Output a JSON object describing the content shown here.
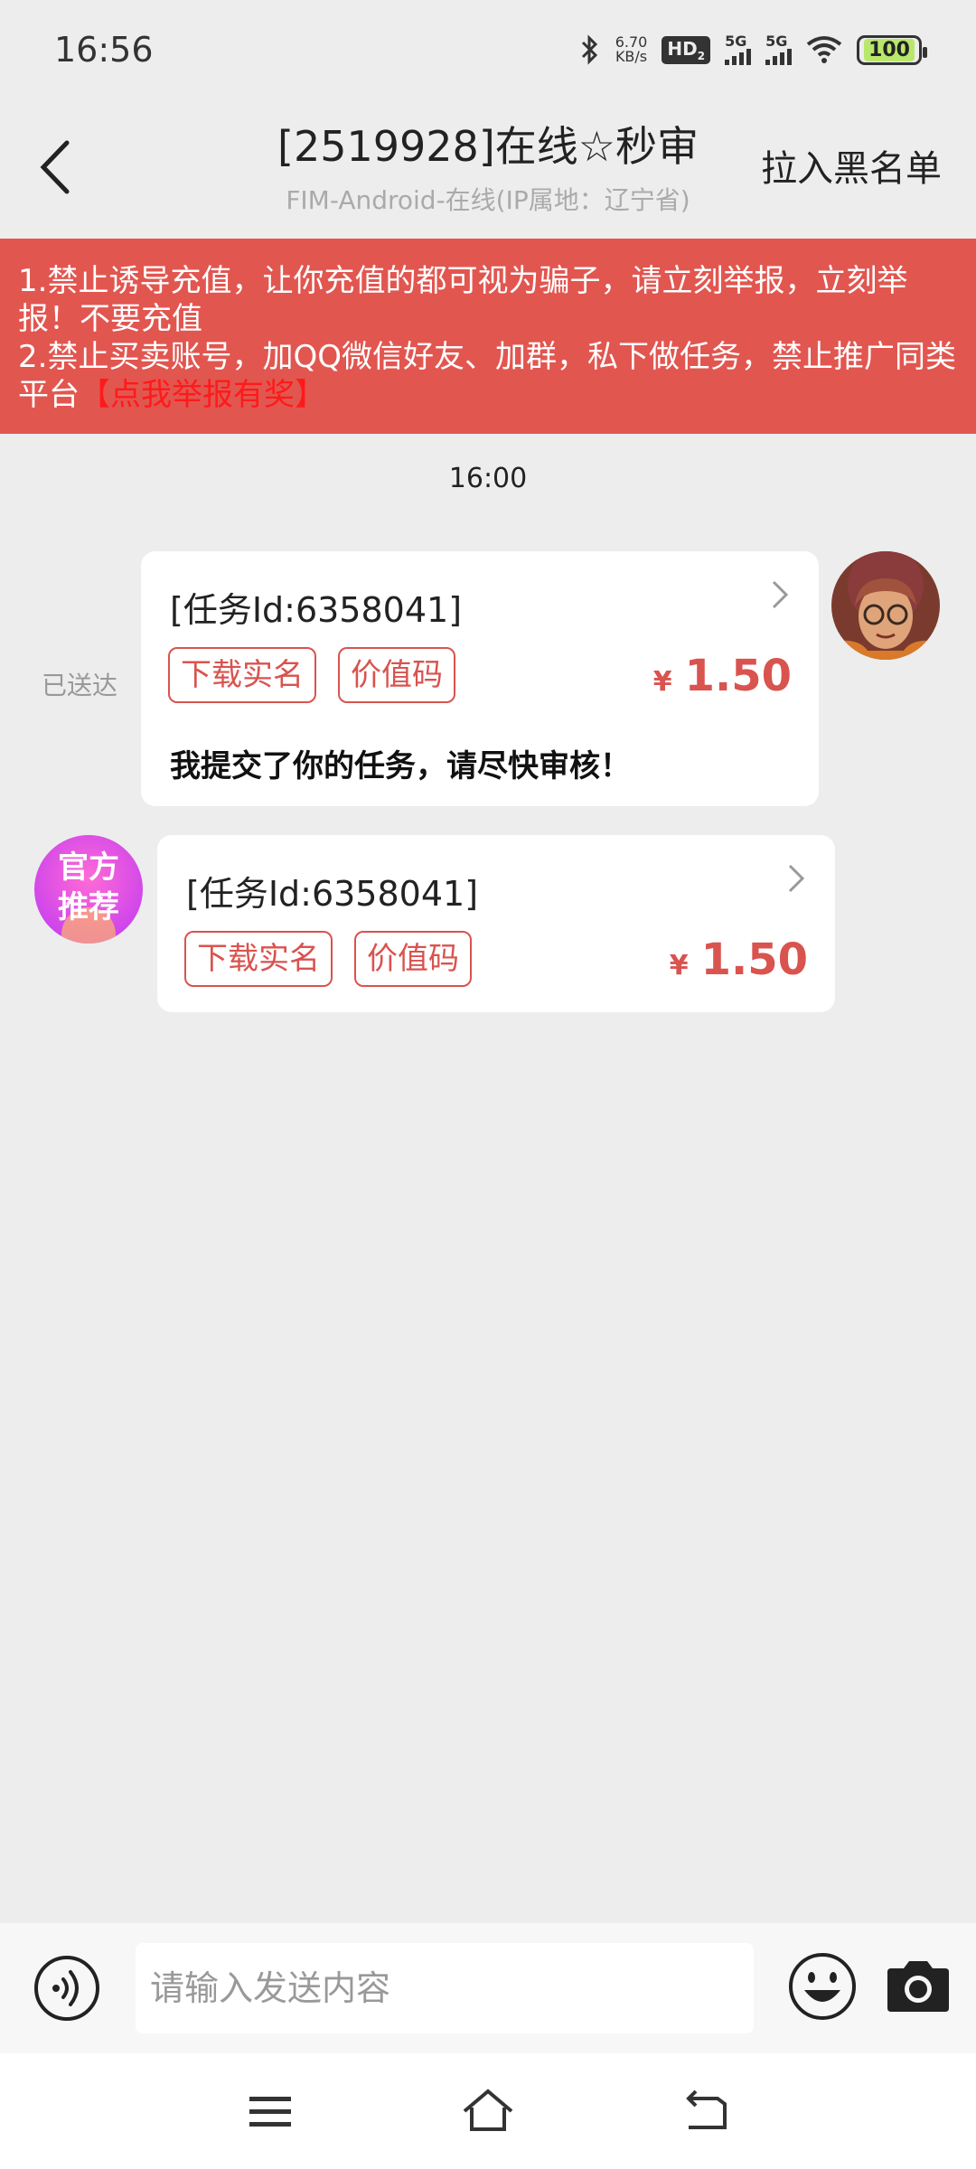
{
  "status_bar": {
    "time": "16:56",
    "net_speed_value": "6.70",
    "net_speed_unit": "KB/s",
    "hd_label": "HD",
    "hd_sub": "2",
    "sim1_label": "5G",
    "sim2_label": "5G",
    "battery": "100"
  },
  "header": {
    "title": "[2519928]在线☆秒审",
    "subtitle": "FIM-Android-在线(IP属地：辽宁省)",
    "blacklist_label": "拉入黑名单"
  },
  "notice": {
    "line1": "1.禁止诱导充值，让你充值的都可视为骗子，请立刻举报，立刻举报！不要充值",
    "line2": "2.禁止买卖账号，加QQ微信好友、加群，私下做任务，禁止推广同类平台",
    "report_link": "【点我举报有奖】"
  },
  "chat": {
    "time": "16:00",
    "messages": [
      {
        "side": "right",
        "status": "已送达",
        "task_id": "[任务Id:6358041]",
        "tags": [
          "下载实名",
          "价值码"
        ],
        "currency": "¥",
        "price": "1.50",
        "text": "我提交了你的任务，请尽快审核！"
      },
      {
        "side": "left",
        "avatar_text_1": "官方",
        "avatar_text_2": "推荐",
        "task_id": "[任务Id:6358041]",
        "tags": [
          "下载实名",
          "价值码"
        ],
        "currency": "¥",
        "price": "1.50"
      }
    ]
  },
  "input": {
    "placeholder": "请输入发送内容"
  },
  "colors": {
    "accent": "#d9534f",
    "notice_bg": "#e25650",
    "background": "#ededed"
  }
}
